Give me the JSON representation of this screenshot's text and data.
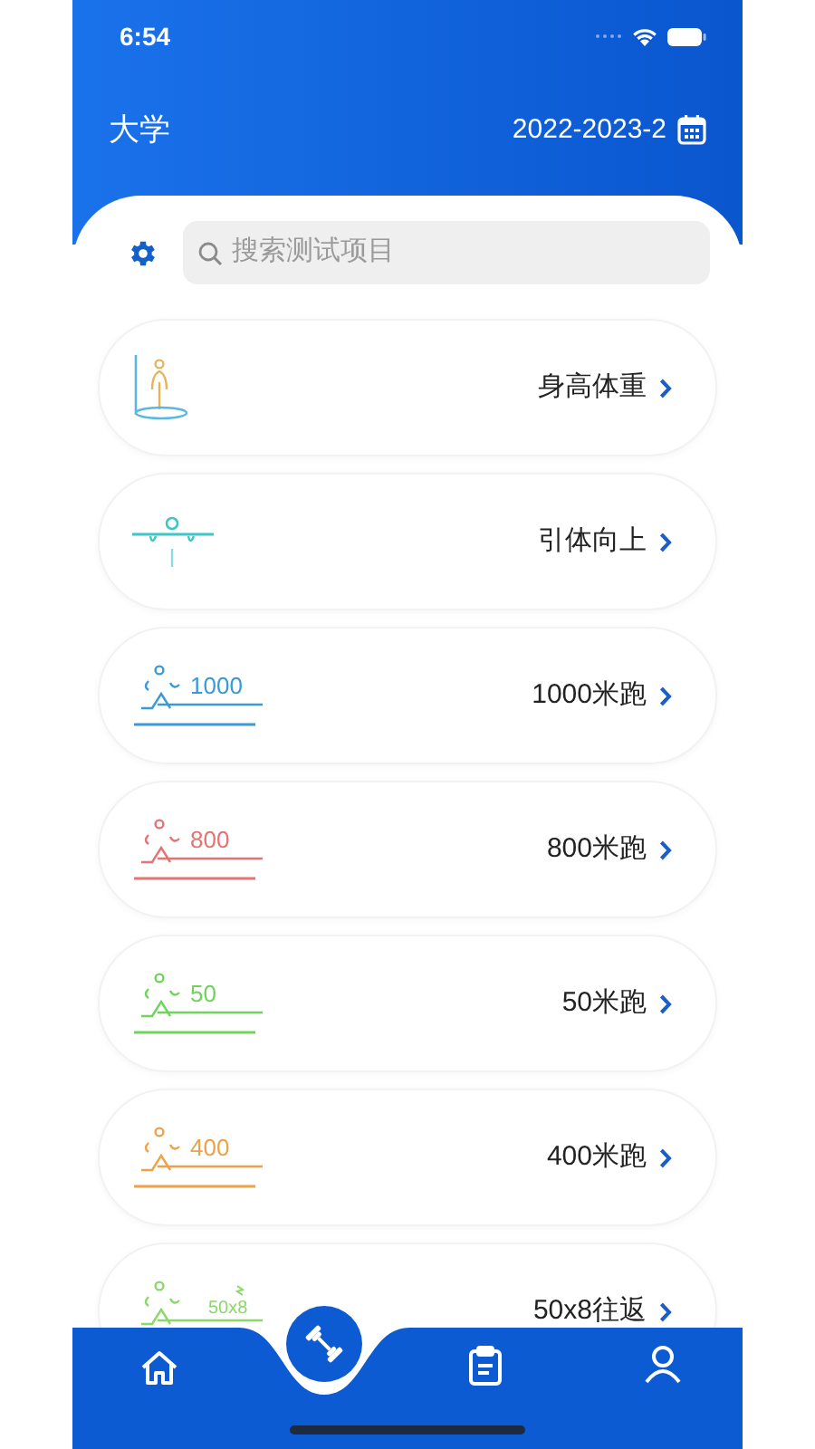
{
  "status_bar": {
    "time": "6:54"
  },
  "header": {
    "title": "大学",
    "term": "2022-2023-2"
  },
  "search": {
    "placeholder": "搜索测试项目"
  },
  "tests": [
    {
      "label": "身高体重",
      "kind": "height",
      "color": "#58b8e0"
    },
    {
      "label": "引体向上",
      "kind": "pullup",
      "color": "#3cc6c6"
    },
    {
      "label": "1000米跑",
      "kind": "run",
      "icon_text": "1000",
      "color": "#3a9ad8"
    },
    {
      "label": "800米跑",
      "kind": "run",
      "icon_text": "800",
      "color": "#e57373"
    },
    {
      "label": "50米跑",
      "kind": "run",
      "icon_text": "50",
      "color": "#6fd45a"
    },
    {
      "label": "400米跑",
      "kind": "run",
      "icon_text": "400",
      "color": "#eda24a"
    },
    {
      "label": "50x8往返",
      "kind": "shuttle",
      "icon_text": "50x8",
      "color": "#8ad86a"
    }
  ],
  "nav": [
    {
      "kind": "home"
    },
    {
      "kind": "fitness"
    },
    {
      "kind": "records"
    },
    {
      "kind": "profile"
    }
  ]
}
